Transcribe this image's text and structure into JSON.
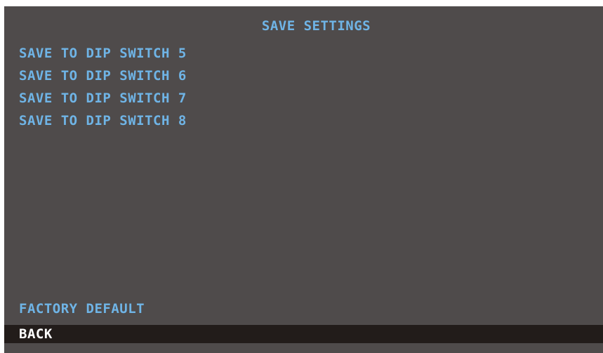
{
  "screen": {
    "title": "SAVE SETTINGS",
    "items": [
      {
        "label": "SAVE TO DIP SWITCH 5"
      },
      {
        "label": "SAVE TO DIP SWITCH 6"
      },
      {
        "label": "SAVE TO DIP SWITCH 7"
      },
      {
        "label": "SAVE TO DIP SWITCH 8"
      }
    ],
    "factory_default": "FACTORY DEFAULT",
    "back": "BACK",
    "selected": "BACK"
  },
  "colors": {
    "background": "#4f4b4b",
    "text": "#6fb4e6",
    "selected_bg": "#221c1a",
    "selected_text": "#ffffff"
  }
}
